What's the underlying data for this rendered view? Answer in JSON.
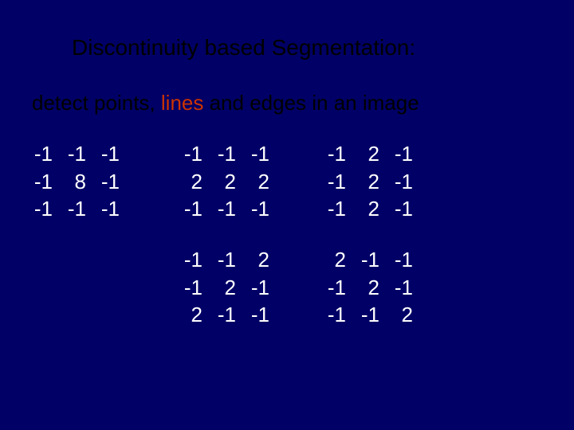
{
  "title": "Discontinuity based Segmentation:",
  "subtitle": {
    "part1": "detect points, ",
    "part2": "lines",
    "part3": " and edges in an image"
  },
  "matrices": {
    "m1": [
      [
        "-1",
        "-1",
        "-1"
      ],
      [
        "-1",
        "8",
        "-1"
      ],
      [
        "-1",
        "-1",
        "-1"
      ]
    ],
    "m2": [
      [
        "-1",
        "-1",
        "-1"
      ],
      [
        "2",
        "2",
        "2"
      ],
      [
        "-1",
        "-1",
        "-1"
      ]
    ],
    "m3": [
      [
        "-1",
        "2",
        "-1"
      ],
      [
        "-1",
        "2",
        "-1"
      ],
      [
        "-1",
        "2",
        "-1"
      ]
    ],
    "m4": [
      [
        "-1",
        "-1",
        "2"
      ],
      [
        "-1",
        "2",
        "-1"
      ],
      [
        "2",
        "-1",
        "-1"
      ]
    ],
    "m5": [
      [
        "2",
        "-1",
        "-1"
      ],
      [
        "-1",
        "2",
        "-1"
      ],
      [
        "-1",
        "-1",
        "2"
      ]
    ]
  }
}
